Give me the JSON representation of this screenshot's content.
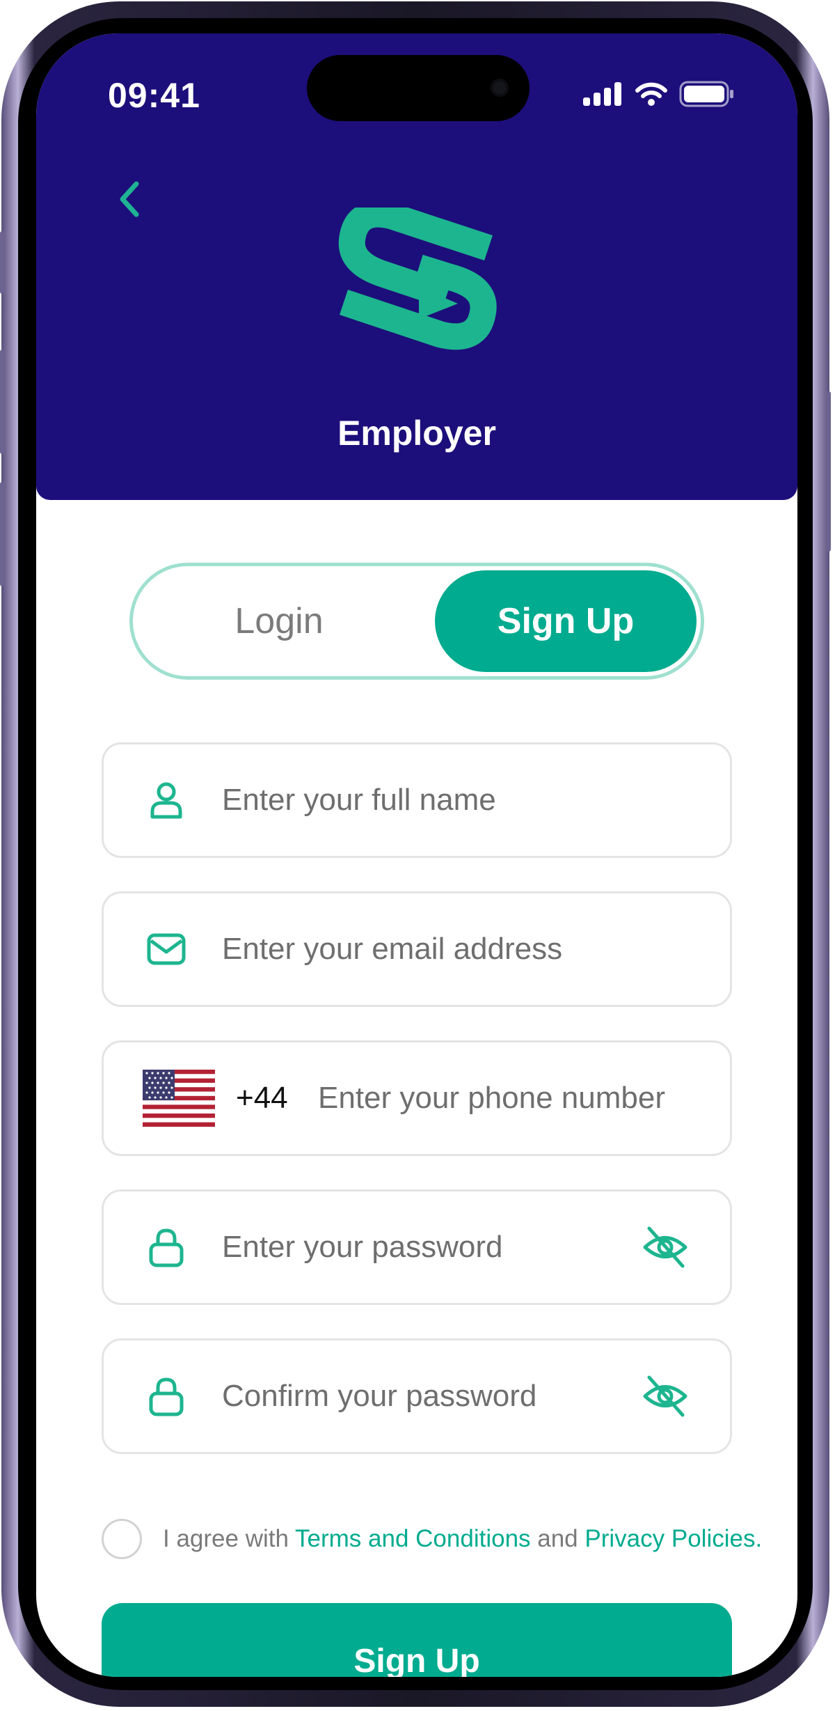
{
  "status_bar": {
    "time": "09:41",
    "icons": [
      "signal-icon",
      "wifi-icon",
      "battery-icon"
    ]
  },
  "header": {
    "back_icon": "chevron-left-icon",
    "logo": "brand-logo",
    "title": "Employer"
  },
  "toggle": {
    "login_label": "Login",
    "signup_label": "Sign Up",
    "selected": "Sign Up"
  },
  "form": {
    "full_name_placeholder": "Enter your full name",
    "email_placeholder": "Enter your email address",
    "phone": {
      "country_flag": "us-flag",
      "dial_code": "+44",
      "placeholder": "Enter your phone number"
    },
    "password_placeholder": "Enter your password",
    "confirm_password_placeholder": "Confirm your password"
  },
  "agreement": {
    "prefix": "I agree with ",
    "terms_link": "Terms and Conditions",
    "middle": " and ",
    "privacy_link": "Privacy Policies."
  },
  "submit_label": "Sign Up",
  "colors": {
    "header_bg": "#1c0f7b",
    "accent": "#00ab8f",
    "toggle_border": "#9fe0cf",
    "field_border": "#e4e4e4",
    "placeholder_text": "#6e6e6e"
  }
}
